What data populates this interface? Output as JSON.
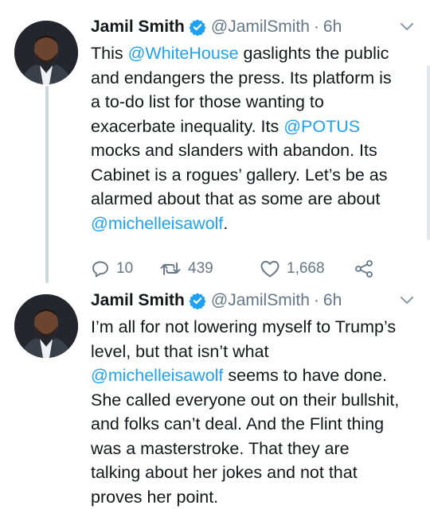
{
  "tweets": [
    {
      "author": {
        "name": "Jamil Smith",
        "handle": "@JamilSmith",
        "time": "6h"
      },
      "separator": "·",
      "text": [
        {
          "t": "This ",
          "m": false
        },
        {
          "t": "@WhiteHouse",
          "m": true
        },
        {
          "t": " gaslights the public\nand endangers the press. Its platform is\na to-do list for those wanting to\nexacerbate inequality. Its ",
          "m": false
        },
        {
          "t": "@POTUS",
          "m": true
        },
        {
          "t": "\nmocks and slanders with abandon. Its\nCabinet is a rogues’ gallery. Let’s be as\nalarmed about that as some are about\n",
          "m": false
        },
        {
          "t": "@michelleisawolf",
          "m": true
        },
        {
          "t": ".",
          "m": false
        }
      ],
      "stats": {
        "replies": "10",
        "retweets": "439",
        "likes": "1,668"
      }
    },
    {
      "author": {
        "name": "Jamil Smith",
        "handle": "@JamilSmith",
        "time": "6h"
      },
      "separator": "·",
      "text": [
        {
          "t": "I’m all for not lowering myself to Trump’s\nlevel, but that isn’t what\n",
          "m": false
        },
        {
          "t": "@michelleisawolf",
          "m": true
        },
        {
          "t": " seems to have done.\nShe called everyone out on their bullshit,\nand folks can’t deal. And the Flint thing\nwas a masterstroke. That they are\ntalking about her jokes and not that\nproves her point.",
          "m": false
        }
      ]
    }
  ],
  "colors": {
    "link": "#1da1f2",
    "secondary": "#657786",
    "text": "#14171a",
    "verified": "#1da1f2"
  },
  "icons": {
    "reply": "reply-icon",
    "retweet": "retweet-icon",
    "like": "heart-icon",
    "share": "share-icon",
    "more": "chevron-down-icon",
    "verified": "verified-badge-icon"
  }
}
